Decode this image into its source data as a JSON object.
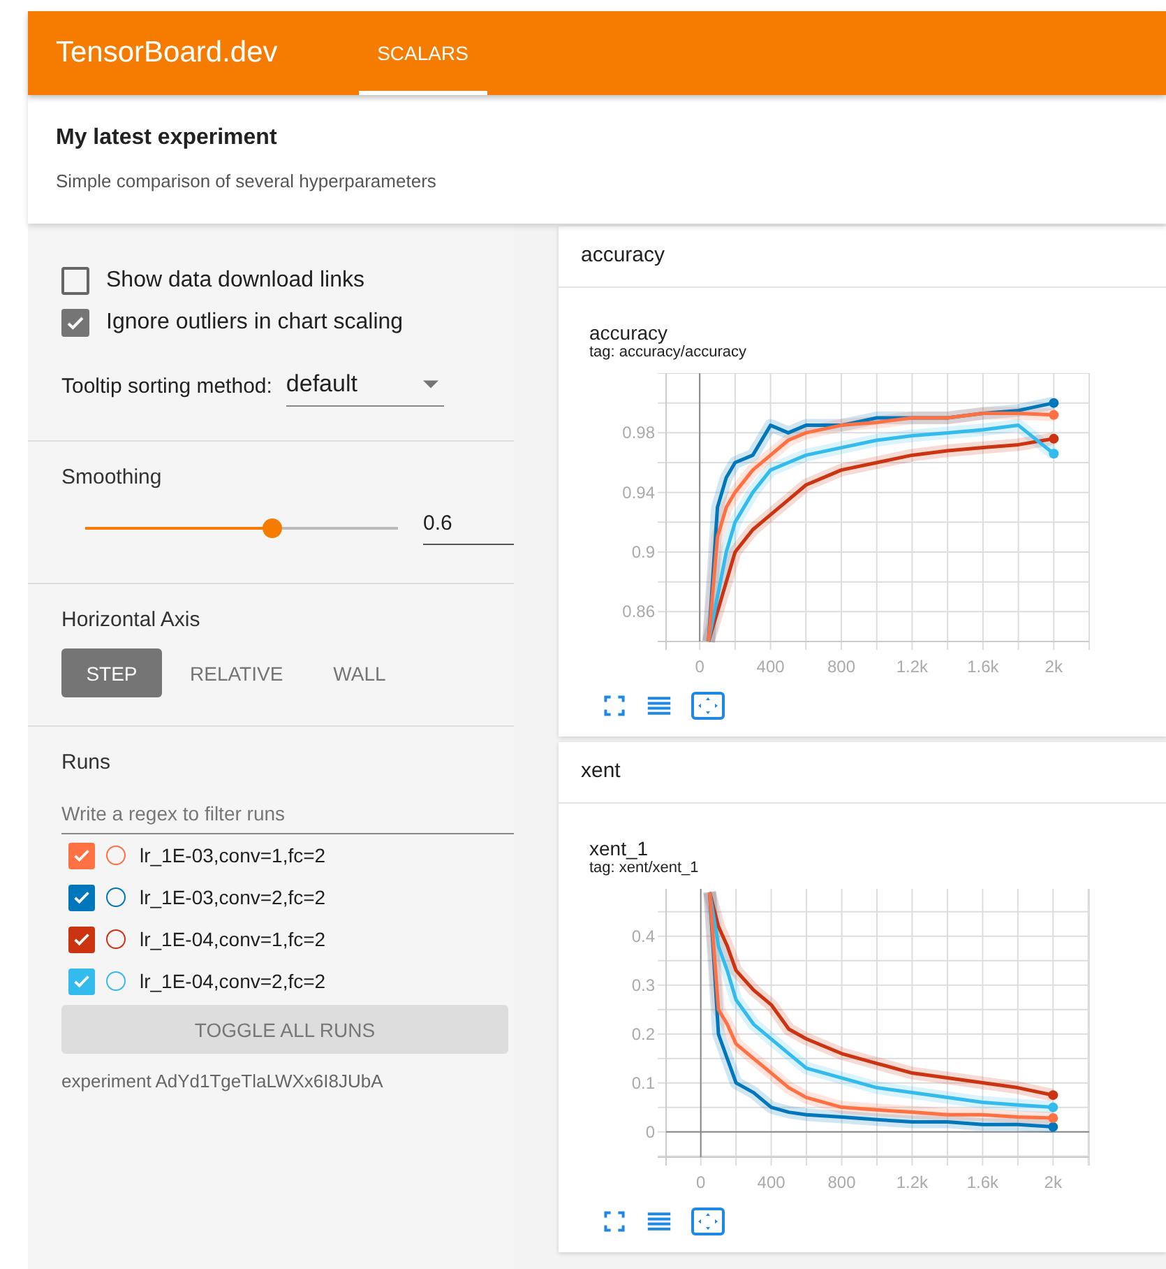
{
  "header": {
    "brand": "TensorBoard.dev",
    "tabs": [
      {
        "label": "SCALARS",
        "selected": true
      }
    ]
  },
  "experiment": {
    "title": "My latest experiment",
    "description": "Simple comparison of several hyperparameters"
  },
  "settings": {
    "checkboxes": [
      {
        "label": "Show data download links",
        "checked": false
      },
      {
        "label": "Ignore outliers in chart scaling",
        "checked": true
      }
    ],
    "tooltip_sorting": {
      "label": "Tooltip sorting method:",
      "value": "default"
    },
    "smoothing": {
      "label": "Smoothing",
      "level": 0.6,
      "value": "0.6"
    },
    "horizontal_axis": {
      "label": "Horizontal Axis",
      "options": [
        {
          "label": "STEP",
          "selected": true
        },
        {
          "label": "RELATIVE",
          "selected": false
        },
        {
          "label": "WALL",
          "selected": false
        }
      ]
    }
  },
  "runs": {
    "label": "Runs",
    "filter_placeholder": "Write a regex to filter runs",
    "items": [
      {
        "name": "lr_1E-03,conv=1,fc=2",
        "checked": true,
        "color": "#ff7043"
      },
      {
        "name": "lr_1E-03,conv=2,fc=2",
        "checked": true,
        "color": "#0077bb"
      },
      {
        "name": "lr_1E-04,conv=1,fc=2",
        "checked": true,
        "color": "#cc3311"
      },
      {
        "name": "lr_1E-04,conv=2,fc=2",
        "checked": true,
        "color": "#33bbee"
      }
    ],
    "toggle_button": "TOGGLE ALL RUNS",
    "experiment_id": "experiment AdYd1TgeTlaLWXx6I8JUbA"
  },
  "cards": [
    {
      "title": "accuracy",
      "chart_title": "accuracy",
      "tag": "tag: accuracy/accuracy",
      "chart_data": {
        "type": "line",
        "x": [
          50,
          100,
          150,
          200,
          300,
          400,
          500,
          600,
          800,
          1000,
          1200,
          1400,
          1600,
          1800,
          2000
        ],
        "series": [
          {
            "color": "#cc3311",
            "values": [
              0.84,
              0.86,
              0.88,
              0.9,
              0.915,
              0.925,
              0.935,
              0.945,
              0.955,
              0.96,
              0.965,
              0.968,
              0.97,
              0.972,
              0.976
            ]
          },
          {
            "color": "#33bbee",
            "values": [
              0.84,
              0.87,
              0.9,
              0.92,
              0.94,
              0.955,
              0.96,
              0.965,
              0.97,
              0.975,
              0.978,
              0.98,
              0.982,
              0.985,
              0.966
            ]
          },
          {
            "color": "#0077bb",
            "values": [
              0.84,
              0.93,
              0.95,
              0.96,
              0.965,
              0.985,
              0.98,
              0.985,
              0.985,
              0.99,
              0.99,
              0.99,
              0.993,
              0.995,
              1.0
            ]
          },
          {
            "color": "#ff7043",
            "values": [
              0.84,
              0.91,
              0.93,
              0.94,
              0.955,
              0.965,
              0.975,
              0.98,
              0.985,
              0.987,
              0.99,
              0.99,
              0.993,
              0.993,
              0.992
            ]
          }
        ],
        "xlim": [
          -190,
          2200
        ],
        "ylim": [
          0.84,
          1.02
        ],
        "grid": true,
        "xticks": [
          0,
          400,
          800,
          {
            "value": 1200,
            "label": "1.2k"
          },
          {
            "value": 1600,
            "label": "1.6k"
          },
          {
            "value": 2000,
            "label": "2k"
          }
        ],
        "yticks": [
          0.86,
          0.9,
          0.94,
          0.98
        ]
      }
    },
    {
      "title": "xent",
      "chart_title": "xent_1",
      "tag": "tag: xent/xent_1",
      "chart_data": {
        "type": "line",
        "x": [
          50,
          100,
          150,
          200,
          300,
          400,
          500,
          600,
          800,
          1000,
          1200,
          1400,
          1600,
          1800,
          2000
        ],
        "series": [
          {
            "color": "#cc3311",
            "values": [
              0.49,
              0.42,
              0.38,
              0.33,
              0.29,
              0.26,
              0.21,
              0.19,
              0.16,
              0.14,
              0.12,
              0.11,
              0.1,
              0.09,
              0.075
            ]
          },
          {
            "color": "#33bbee",
            "values": [
              0.49,
              0.38,
              0.33,
              0.27,
              0.22,
              0.19,
              0.16,
              0.13,
              0.11,
              0.09,
              0.08,
              0.07,
              0.06,
              0.055,
              0.05
            ]
          },
          {
            "color": "#0077bb",
            "values": [
              0.49,
              0.2,
              0.15,
              0.1,
              0.08,
              0.05,
              0.04,
              0.035,
              0.03,
              0.025,
              0.02,
              0.02,
              0.015,
              0.015,
              0.01
            ]
          },
          {
            "color": "#ff7043",
            "values": [
              0.49,
              0.25,
              0.22,
              0.18,
              0.15,
              0.12,
              0.09,
              0.07,
              0.05,
              0.045,
              0.04,
              0.035,
              0.035,
              0.03,
              0.028
            ]
          }
        ],
        "xlim": [
          -197,
          2205
        ],
        "ylim": [
          -0.052,
          0.497
        ],
        "grid": true,
        "xticks": [
          0,
          400,
          800,
          {
            "value": 1200,
            "label": "1.2k"
          },
          {
            "value": 1600,
            "label": "1.6k"
          },
          {
            "value": 2000,
            "label": "2k"
          }
        ],
        "yticks": [
          0,
          0.1,
          0.2,
          0.3,
          0.4
        ]
      }
    }
  ]
}
